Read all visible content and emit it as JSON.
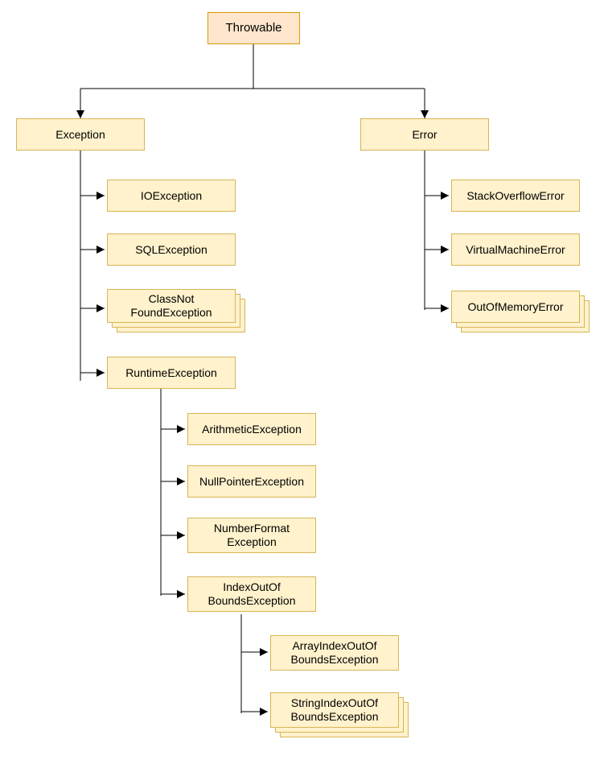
{
  "nodes": {
    "throwable": "Throwable",
    "exception": "Exception",
    "error": "Error",
    "ioexception": "IOException",
    "sqlexception": "SQLException",
    "classnotfound": "ClassNot\nFoundException",
    "runtimeexception": "RuntimeException",
    "arithmetic": "ArithmeticException",
    "nullpointer": "NullPointerException",
    "numberformat": "NumberFormat\nException",
    "indexoob": "IndexOutOf\nBoundsException",
    "arrayindex": "ArrayIndexOutOf\nBoundsException",
    "stringindex": "StringIndexOutOf\nBoundsException",
    "stackoverflow": "StackOverflowError",
    "virtualmachine": "VirtualMachineError",
    "outofmemory": "OutOfMemoryError"
  }
}
